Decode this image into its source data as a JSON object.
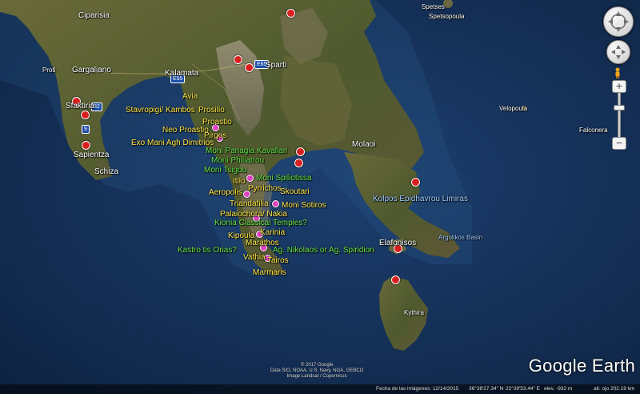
{
  "map": {
    "towns": [
      {
        "name": "Ciparisia"
      },
      {
        "name": "Gargaliano"
      },
      {
        "name": "Kalamata"
      },
      {
        "name": "Sparti"
      },
      {
        "name": "Sfaktiria"
      },
      {
        "name": "Sapientza"
      },
      {
        "name": "Schiza"
      },
      {
        "name": "Molaoi"
      },
      {
        "name": "Elafonisos"
      },
      {
        "name": "Kythira"
      },
      {
        "name": "Spetses"
      },
      {
        "name": "Spetsopoula"
      },
      {
        "name": "Velopoula"
      },
      {
        "name": "Falconera"
      },
      {
        "name": "Proti"
      }
    ],
    "sites": [
      {
        "name": "Avia"
      },
      {
        "name": "Stavropigi/ Kambos"
      },
      {
        "name": "Prosilio"
      },
      {
        "name": "Proastio"
      },
      {
        "name": "Neo Proastio"
      },
      {
        "name": "Pirgos"
      },
      {
        "name": "Exo Mani Agh Dimitrios"
      },
      {
        "name": "Itilo"
      },
      {
        "name": "Aeropolis"
      },
      {
        "name": "Pyrrichos"
      },
      {
        "name": "Skoutari"
      },
      {
        "name": "Triandafilia"
      },
      {
        "name": "Moni Sotiros"
      },
      {
        "name": "Palaiochora/ Nakia"
      },
      {
        "name": "Karinia"
      },
      {
        "name": "Kipoula"
      },
      {
        "name": "Marathos"
      },
      {
        "name": "Vathia"
      },
      {
        "name": "Tairos"
      },
      {
        "name": "Marmaris"
      }
    ],
    "monasteries": [
      {
        "name": "Moni Panagia Kavallari"
      },
      {
        "name": "Moni Philiatrou"
      },
      {
        "name": "Moni Tsigou"
      },
      {
        "name": "Moni Spiliotissa"
      },
      {
        "name": "Kionia Classical Temples?"
      },
      {
        "name": "Kastro tis Orias?"
      },
      {
        "name": "Ag. Nikolaos or Ag. Spiridion"
      }
    ],
    "water": [
      {
        "name": "Kolpos Epidhavrou Limiras"
      },
      {
        "name": "Argolikos Basin"
      }
    ],
    "road_shields": [
      "E55",
      "E65",
      "82",
      "9"
    ],
    "colors": {
      "sea": "#16345e",
      "land": "#4a5a2c",
      "town_label": "#ffffff",
      "site_label": "#ffe94a",
      "monastery_label": "#67e84a",
      "pin": "#d92020"
    }
  },
  "navigation": {
    "compass_icon": "compass-icon",
    "look_icon": "look-joystick-icon",
    "move_icon": "move-joystick-icon",
    "pegman_icon": "street-view-pegman-icon",
    "zoom_in": "+",
    "zoom_out": "−"
  },
  "branding": {
    "logo": "Google Earth"
  },
  "credits": {
    "line1": "© 2017 Google",
    "line2": "Data SIO, NOAA, U.S. Navy, NGA, GEBCO",
    "line3": "Image Landsat / Copernicus"
  },
  "status": {
    "imagery_date": "Fecha de las imágenes: 12/14/2015",
    "lat": "36°38'27.34\" N",
    "lon": "22°39'53.44\" E",
    "elev": "elev.  -932 m",
    "eye_alt": "alt. ojo 202.19 km"
  }
}
